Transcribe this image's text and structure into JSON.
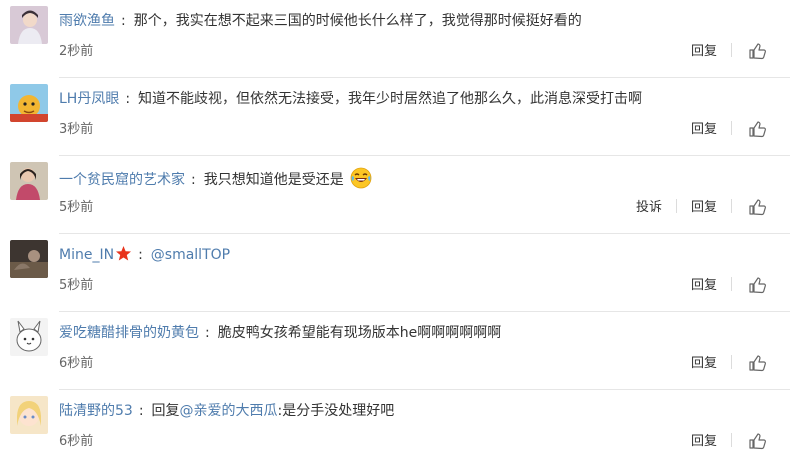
{
  "labels": {
    "reply": "回复",
    "report": "投诉"
  },
  "comments": [
    {
      "username": "雨欲渔鱼",
      "text": "那个，我实在想不起来三国的时候他长什么样了，我觉得那时候挺好看的",
      "time": "2秒前"
    },
    {
      "username": "LH丹凤眼",
      "text": "知道不能歧视，但依然无法接受，我年少时居然追了他那么久，此消息深受打击啊",
      "time": "3秒前"
    },
    {
      "username": "一个贫民窟的艺术家",
      "text": "我只想知道他是受还是",
      "time": "5秒前",
      "emoji": "laughing-tears"
    },
    {
      "username": "Mine_IN",
      "mention": "@smallTOP",
      "time": "5秒前",
      "badge": "red-star"
    },
    {
      "username": "爱吃糖醋排骨的奶黄包",
      "text": "脆皮鸭女孩希望能有现场版本he啊啊啊啊啊啊",
      "time": "6秒前"
    },
    {
      "username": "陆清野的53",
      "text_prefix": "回复",
      "mention": "@亲爱的大西瓜",
      "text": ":是分手没处理好吧",
      "time": "6秒前"
    }
  ],
  "colors": {
    "link": "#4f7cad",
    "text": "#333333",
    "muted": "#666666",
    "divider": "#e6e6e6",
    "star": "#e8341c"
  }
}
